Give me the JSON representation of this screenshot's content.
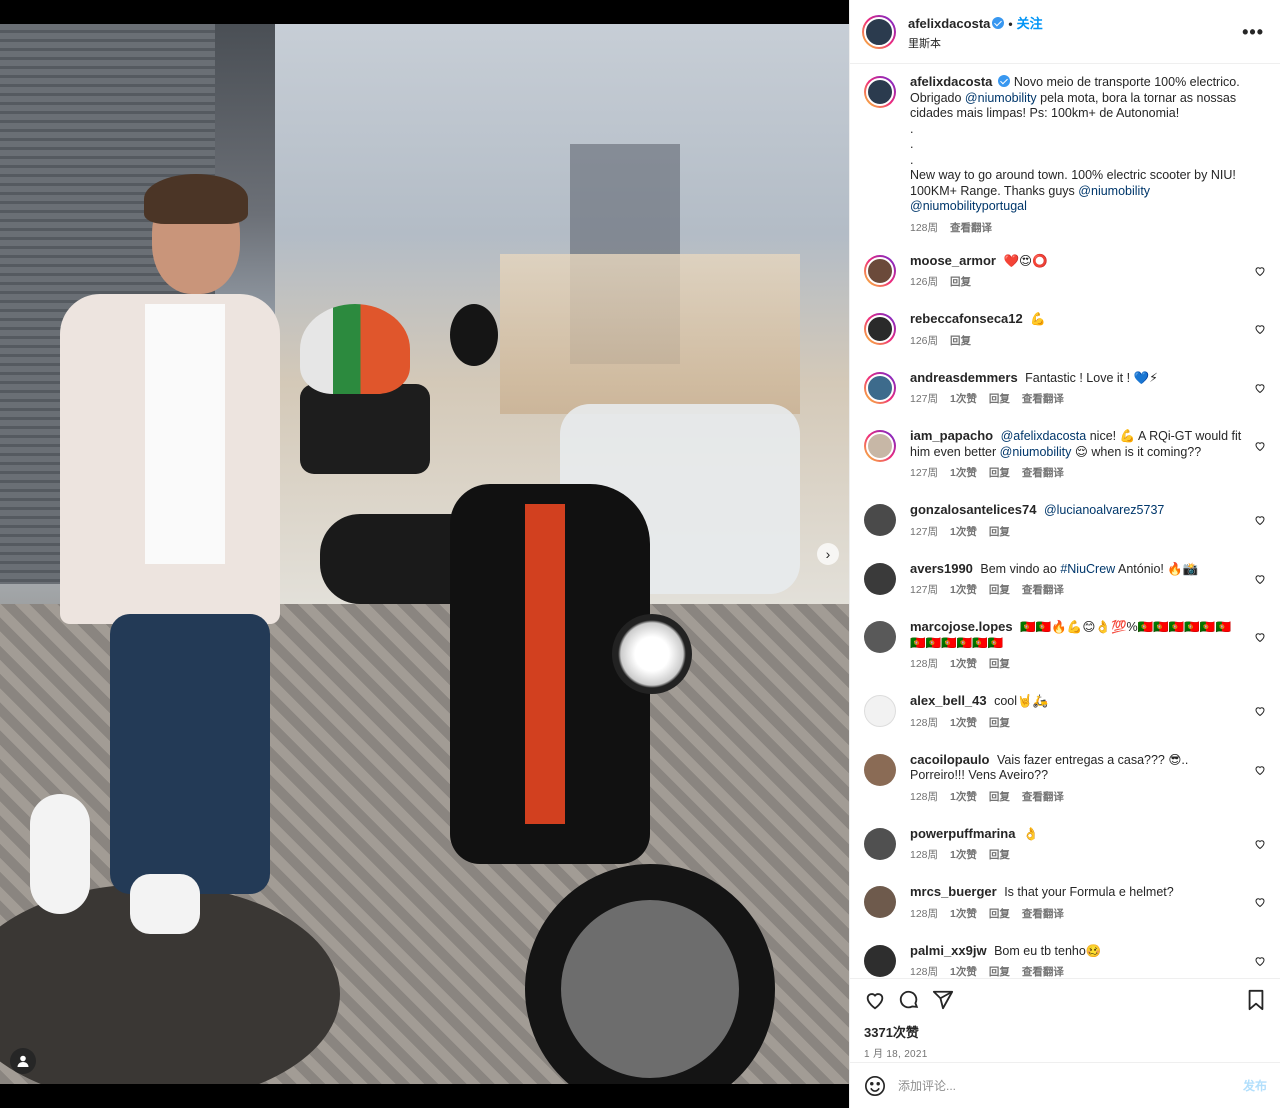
{
  "post": {
    "author": "afelixdacosta",
    "follow_label": "关注",
    "location": "里斯本",
    "more_label": "•••",
    "caption": {
      "text1": "Novo meio de transporte 100% electrico. Obrigado",
      "mention1": "@niumobility",
      "text2": "pela mota, bora la tornar as nossas cidades mais limpas! Ps: 100km+ de Autonomia!",
      "dot1": ".",
      "dot2": ".",
      "dot3": ".",
      "text3": "New way to go around town. 100% electric scooter by NIU! 100KM+ Range. Thanks guys",
      "mention2": "@niumobility",
      "mention3": "@niumobilityportugal",
      "time": "128周",
      "translate": "查看翻译"
    },
    "likes": "3371次赞",
    "date": "1 月 18, 2021",
    "add_comment_placeholder": "添加评论...",
    "post_label": "发布",
    "slide_next": "›"
  },
  "comments": [
    {
      "user": "moose_armor",
      "text": "❤️😍⭕",
      "time": "126周",
      "likes": "",
      "reply": "回复",
      "translate": ""
    },
    {
      "user": "rebeccafonseca12",
      "text": "💪",
      "time": "126周",
      "likes": "",
      "reply": "回复",
      "translate": ""
    },
    {
      "user": "andreasdemmers",
      "text": "Fantastic ! Love it ! 💙⚡",
      "time": "127周",
      "likes": "1次赞",
      "reply": "回复",
      "translate": "查看翻译"
    },
    {
      "user": "iam_papacho",
      "mention": "@afelixdacosta",
      "text": "nice! 💪 A RQi-GT would fit him even better",
      "mention2": "@niumobility",
      "text2": "😌 when is it coming??",
      "time": "127周",
      "likes": "1次赞",
      "reply": "回复",
      "translate": "查看翻译"
    },
    {
      "user": "gonzalosantelices74",
      "mention": "@lucianoalvarez5737",
      "time": "127周",
      "likes": "1次赞",
      "reply": "回复",
      "translate": ""
    },
    {
      "user": "avers1990",
      "text": "Bem vindo ao",
      "mention": "#NiuCrew",
      "text2": "António! 🔥📸",
      "time": "127周",
      "likes": "1次赞",
      "reply": "回复",
      "translate": "查看翻译"
    },
    {
      "user": "marcojose.lopes",
      "text": "🇵🇹🇵🇹🔥💪😊👌💯%🇵🇹🇵🇹🇵🇹🇵🇹🇵🇹🇵🇹🇵🇹🇵🇹🇵🇹🇵🇹🇵🇹🇵🇹",
      "time": "128周",
      "likes": "1次赞",
      "reply": "回复",
      "translate": ""
    },
    {
      "user": "alex_bell_43",
      "text": "cool🤘🛵",
      "time": "128周",
      "likes": "1次赞",
      "reply": "回复",
      "translate": ""
    },
    {
      "user": "cacoilopaulo",
      "text": "Vais fazer entregas a casa??? 😎.. Porreiro!!! Vens Aveiro??",
      "time": "128周",
      "likes": "1次赞",
      "reply": "回复",
      "translate": "查看翻译"
    },
    {
      "user": "powerpuffmarina",
      "text": "👌",
      "time": "128周",
      "likes": "1次赞",
      "reply": "回复",
      "translate": ""
    },
    {
      "user": "mrcs_buerger",
      "text": "Is that your Formula e helmet?",
      "time": "128周",
      "likes": "1次赞",
      "reply": "回复",
      "translate": "查看翻译"
    },
    {
      "user": "palmi_xx9jw",
      "text": "Bom eu tb tenho🥴",
      "time": "128周",
      "likes": "1次赞",
      "reply": "回复",
      "translate": "查看翻译"
    }
  ],
  "icons": {
    "like": "heart-icon",
    "comment": "comment-icon",
    "share": "share-icon",
    "save": "bookmark-icon",
    "emoji": "emoji-icon",
    "tag": "user-tag-icon",
    "more": "more-options-icon",
    "verified": "verified-badge-icon"
  },
  "colors": {
    "accent": "#0095f6",
    "mention": "#00376b",
    "meta": "#737373",
    "post_disabled": "#b2dffc",
    "verified": "#3897f0"
  }
}
